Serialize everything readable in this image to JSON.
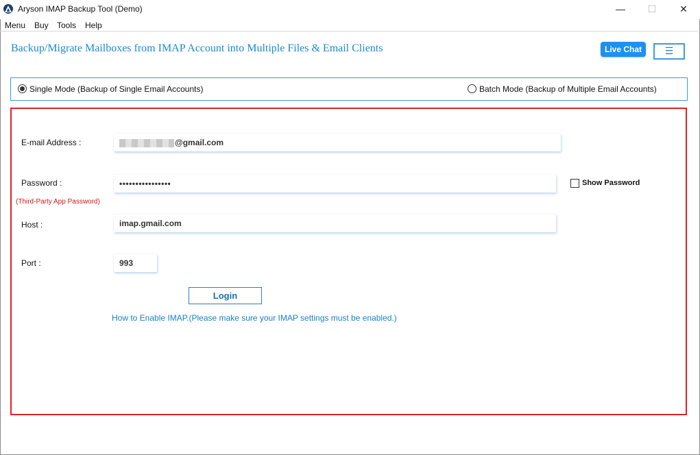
{
  "window": {
    "title": "Aryson IMAP Backup Tool (Demo)",
    "minimize_glyph": "—",
    "maximize_glyph": "☐",
    "close_glyph": "✕"
  },
  "menu": {
    "items": [
      "Menu",
      "Buy",
      "Tools",
      "Help"
    ]
  },
  "header": {
    "headline": "Backup/Migrate Mailboxes from IMAP Account into Multiple Files & Email Clients",
    "live_chat_label": "Live Chat",
    "hamburger_glyph": "☰"
  },
  "modes": {
    "single": {
      "label": "Single Mode (Backup of Single Email Accounts)",
      "selected": true
    },
    "batch": {
      "label": "Batch Mode (Backup of Multiple Email Accounts)",
      "selected": false
    }
  },
  "form": {
    "email_label": "E-mail Address :",
    "email_value_suffix": "@gmail.com",
    "password_label": "Password :",
    "password_hint": "(Third-Party App Password)",
    "password_value": "••••••••••••••••",
    "show_password_label": "Show Password",
    "show_password_checked": false,
    "host_label": "Host :",
    "host_value": "imap.gmail.com",
    "port_label": "Port :",
    "port_value": "993",
    "login_label": "Login",
    "imap_help_link": "How to Enable IMAP.(Please make sure your IMAP settings must be enabled.)"
  },
  "colors": {
    "accent_blue": "#1a8ad4",
    "panel_border_red": "#e0202a",
    "live_chat_bg": "#1e90f0"
  }
}
